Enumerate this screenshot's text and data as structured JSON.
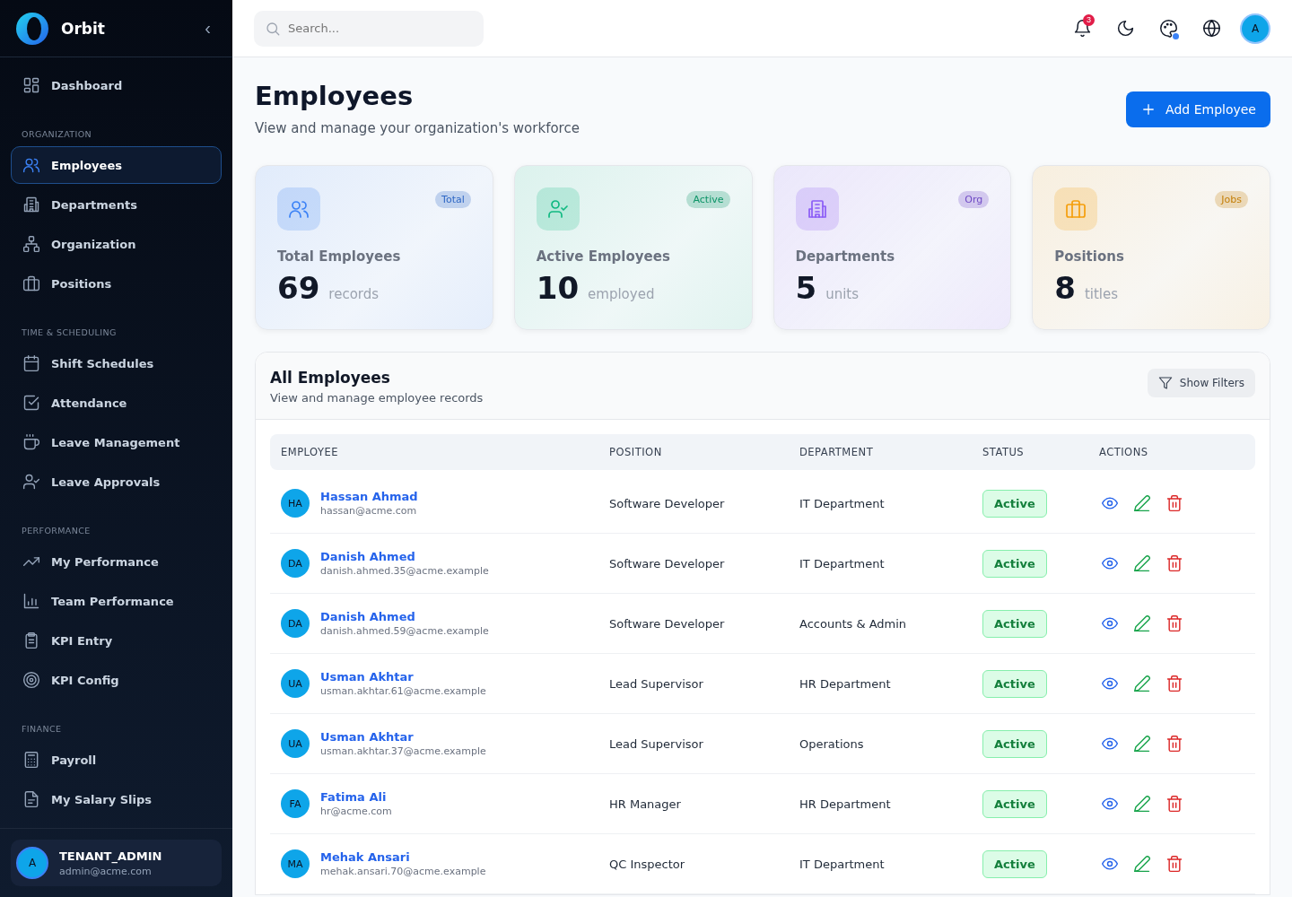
{
  "sidebar": {
    "brand": "Orbit",
    "collapse": "‹",
    "items_top": [
      {
        "label": "Dashboard",
        "selected": false
      }
    ],
    "sections": [
      {
        "title": "ORGANIZATION",
        "items": [
          {
            "label": "Employees",
            "selected": true
          },
          {
            "label": "Departments",
            "selected": false
          },
          {
            "label": "Organization",
            "selected": false
          },
          {
            "label": "Positions",
            "selected": false
          }
        ]
      },
      {
        "title": "TIME & SCHEDULING",
        "items": [
          {
            "label": "Shift Schedules",
            "selected": false
          },
          {
            "label": "Attendance",
            "selected": false
          },
          {
            "label": "Leave Management",
            "selected": false
          },
          {
            "label": "Leave Approvals",
            "selected": false
          }
        ]
      },
      {
        "title": "PERFORMANCE",
        "items": [
          {
            "label": "My Performance",
            "selected": false
          },
          {
            "label": "Team Performance",
            "selected": false
          },
          {
            "label": "KPI Entry",
            "selected": false
          },
          {
            "label": "KPI Config",
            "selected": false
          }
        ]
      },
      {
        "title": "FINANCE",
        "items": [
          {
            "label": "Payroll",
            "selected": false
          },
          {
            "label": "My Salary Slips",
            "selected": false
          }
        ]
      }
    ],
    "user": {
      "initial": "A",
      "name": "TENANT_ADMIN",
      "email": "admin@acme.com"
    }
  },
  "topbar": {
    "search": {
      "placeholder": "Search..."
    },
    "notification_count": "3",
    "avatar": "A"
  },
  "page": {
    "title": "Employees",
    "subtitle": "View and manage your organization's workforce",
    "add_button": "Add Employee"
  },
  "stats": [
    {
      "label": "Total Employees",
      "value": "69",
      "unit": "records",
      "tag": "Total",
      "color": "#3b82f6"
    },
    {
      "label": "Active Employees",
      "value": "10",
      "unit": "employed",
      "tag": "Active",
      "color": "#10b981"
    },
    {
      "label": "Departments",
      "value": "5",
      "unit": "units",
      "tag": "Org",
      "color": "#8b5cf6"
    },
    {
      "label": "Positions",
      "value": "8",
      "unit": "titles",
      "tag": "Jobs",
      "color": "#f59e0b"
    }
  ],
  "table": {
    "title": "All Employees",
    "subtitle": "View and manage employee records",
    "filter_button": "Show Filters",
    "columns": [
      "EMPLOYEE",
      "POSITION",
      "DEPARTMENT",
      "STATUS",
      "ACTIONS"
    ],
    "rows": [
      {
        "initials": "HA",
        "name": "Hassan Ahmad",
        "email": "hassan@acme.com",
        "position": "Software Developer",
        "department": "IT Department",
        "status": "Active"
      },
      {
        "initials": "DA",
        "name": "Danish Ahmed",
        "email": "danish.ahmed.35@acme.example",
        "position": "Software Developer",
        "department": "IT Department",
        "status": "Active"
      },
      {
        "initials": "DA",
        "name": "Danish Ahmed",
        "email": "danish.ahmed.59@acme.example",
        "position": "Software Developer",
        "department": "Accounts & Admin",
        "status": "Active"
      },
      {
        "initials": "UA",
        "name": "Usman Akhtar",
        "email": "usman.akhtar.61@acme.example",
        "position": "Lead Supervisor",
        "department": "HR Department",
        "status": "Active"
      },
      {
        "initials": "UA",
        "name": "Usman Akhtar",
        "email": "usman.akhtar.37@acme.example",
        "position": "Lead Supervisor",
        "department": "Operations",
        "status": "Active"
      },
      {
        "initials": "FA",
        "name": "Fatima Ali",
        "email": "hr@acme.com",
        "position": "HR Manager",
        "department": "HR Department",
        "status": "Active"
      },
      {
        "initials": "MA",
        "name": "Mehak Ansari",
        "email": "mehak.ansari.70@acme.example",
        "position": "QC Inspector",
        "department": "IT Department",
        "status": "Active"
      }
    ]
  }
}
